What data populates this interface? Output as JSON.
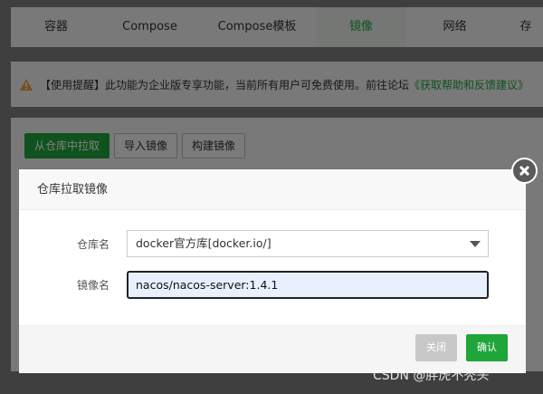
{
  "tabs": [
    {
      "label": "容器"
    },
    {
      "label": "Compose"
    },
    {
      "label": "Compose模板"
    },
    {
      "label": "镜像"
    },
    {
      "label": "网络"
    },
    {
      "label": "存"
    }
  ],
  "notice": {
    "text": "【使用提醒】此功能为企业版专享功能，当前所有用户可免费使用。前往论坛",
    "link_text": "《获取帮助和反馈建议》",
    "icon": "warning-icon"
  },
  "toolbar": {
    "pull_label": "从仓库中拉取",
    "import_label": "导入镜像",
    "build_label": "构建镜像"
  },
  "dialog": {
    "title": "仓库拉取镜像",
    "repo_label": "仓库名",
    "repo_value": "docker官方库[docker.io/]",
    "image_label": "镜像名",
    "image_value": "nacos/nacos-server:1.4.1",
    "close_label": "关闭",
    "confirm_label": "确认"
  },
  "watermark": "CSDN @胖虎不秃头",
  "colors": {
    "accent": "#20a53a",
    "warning": "#e6a23c"
  }
}
